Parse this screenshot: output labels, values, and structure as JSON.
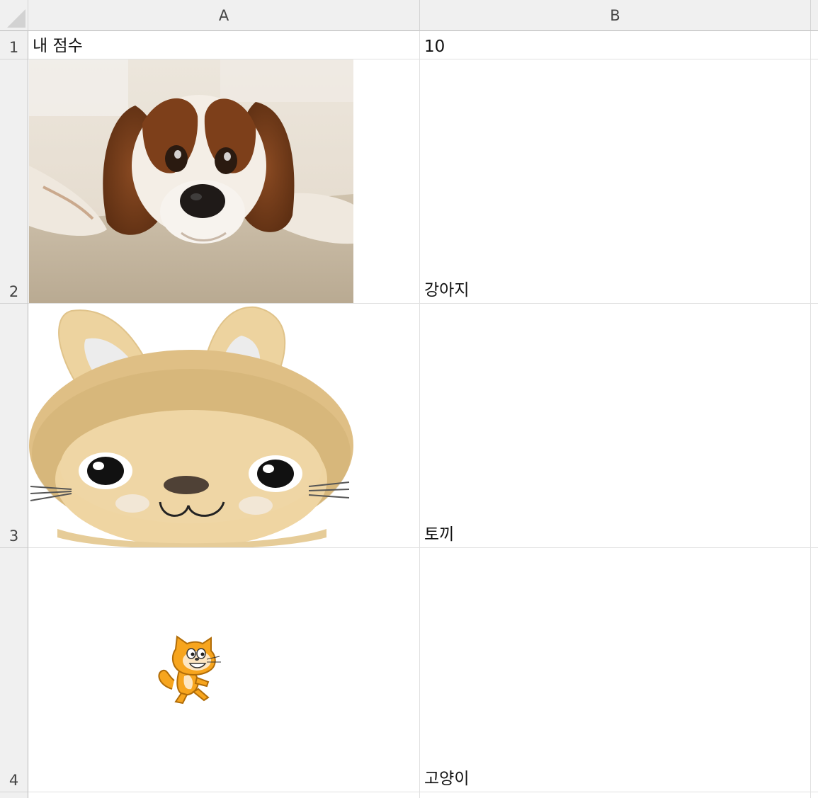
{
  "columns": [
    "A",
    "B"
  ],
  "rows": [
    "1",
    "2",
    "3",
    "4"
  ],
  "cells": {
    "a1": "내 점수",
    "b1": "10",
    "b2": "강아지",
    "b3": "토끼",
    "b4": "고양이"
  },
  "images": {
    "dog": "dog-photo",
    "rabbit": "rabbit-illustration",
    "cat": "cat-sprite"
  },
  "colors": {
    "header_bg": "#f0f0f0",
    "grid": "#e1e1e1",
    "rabbit_fur": "#e8cc96",
    "cat_orange": "#f7a51e"
  }
}
